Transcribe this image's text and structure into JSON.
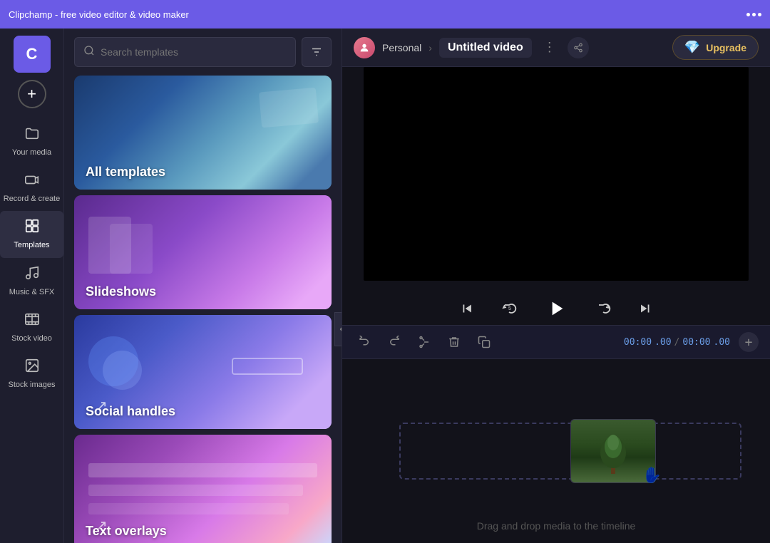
{
  "titlebar": {
    "title": "Clipchamp - free video editor & video maker",
    "more_icon": "⋯"
  },
  "sidebar": {
    "logo": "C",
    "add_label": "+",
    "items": [
      {
        "id": "your-media",
        "icon": "🗂",
        "label": "Your media",
        "active": false
      },
      {
        "id": "record-create",
        "icon": "📹",
        "label": "Record &\ncreate",
        "active": false
      },
      {
        "id": "templates",
        "icon": "⊞",
        "label": "Templates",
        "active": true
      },
      {
        "id": "music-sfx",
        "icon": "🎵",
        "label": "Music & SFX",
        "active": false
      },
      {
        "id": "stock-video",
        "icon": "🎞",
        "label": "Stock video",
        "active": false
      },
      {
        "id": "stock-images",
        "icon": "🖼",
        "label": "Stock images",
        "active": false
      }
    ]
  },
  "templates_panel": {
    "search_placeholder": "Search templates",
    "filter_icon": "≡",
    "cards": [
      {
        "id": "all-templates",
        "label": "All templates"
      },
      {
        "id": "slideshows",
        "label": "Slideshows"
      },
      {
        "id": "social-handles",
        "label": "Social handles"
      },
      {
        "id": "text-overlays",
        "label": "Text overlays"
      }
    ]
  },
  "topbar": {
    "personal_label": "Personal",
    "breadcrumb_sep": "›",
    "video_title": "Untitled video",
    "more_icon": "⋮",
    "upgrade_label": "Upgrade",
    "diamond": "💎"
  },
  "timeline": {
    "undo_icon": "↺",
    "redo_icon": "↻",
    "cut_icon": "✂",
    "delete_icon": "🗑",
    "copy_icon": "⧉",
    "time_current": "00:00",
    "time_ms_current": ".00",
    "time_sep": "/",
    "time_total": "00:00",
    "time_ms_total": ".00",
    "add_track_icon": "+",
    "drop_hint": "Drag and drop media to the timeline"
  },
  "playback": {
    "skip_back_icon": "⏮",
    "rewind_icon": "↺",
    "play_icon": "▶",
    "forward_icon": "↻",
    "skip_forward_icon": "⏭"
  }
}
